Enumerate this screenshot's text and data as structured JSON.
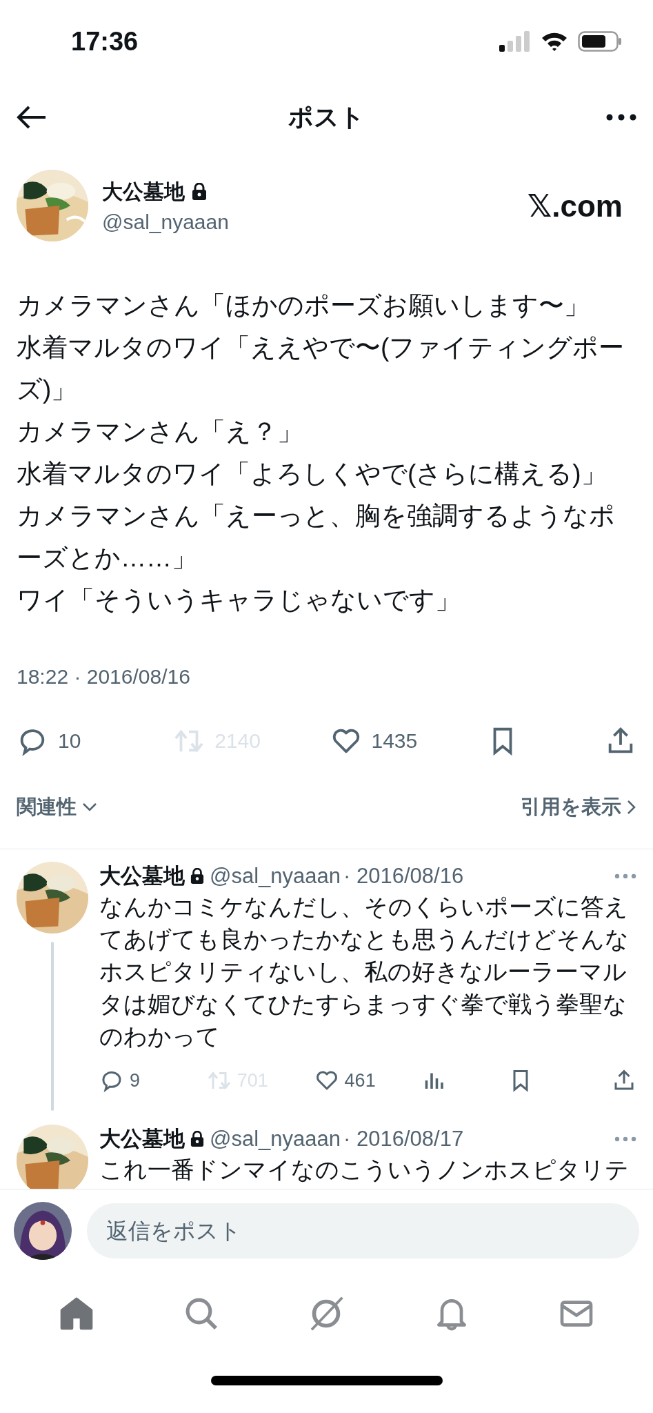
{
  "status_bar": {
    "time": "17:36"
  },
  "header": {
    "title": "ポスト"
  },
  "post": {
    "author": {
      "name": "大公墓地",
      "handle": "@sal_nyaaan",
      "locked": true
    },
    "source_label": "𝕏.com",
    "text_lines": [
      "カメラマンさん「ほかのポーズお願いします〜」",
      "水着マルタのワイ「ええやで〜(ファイティングポーズ)」",
      "カメラマンさん「え？」",
      "水着マルタのワイ「よろしくやで(さらに構える)」",
      "カメラマンさん「えーっと、胸を強調するようなポーズとか……」",
      "ワイ「そういうキャラじゃないです」"
    ],
    "timestamp": "18:22 · 2016/08/16",
    "actions": [
      {
        "kind": "reply",
        "count": "10",
        "disabled": false
      },
      {
        "kind": "repost",
        "count": "2140",
        "disabled": true
      },
      {
        "kind": "like",
        "count": "1435",
        "disabled": false
      },
      {
        "kind": "bookmark",
        "disabled": false
      },
      {
        "kind": "share",
        "disabled": false
      }
    ],
    "sort_label": "関連性",
    "quotes_link": "引用を表示"
  },
  "replies": [
    {
      "name": "大公墓地",
      "locked": true,
      "handle": "@sal_nyaaan",
      "date": "· 2016/08/16",
      "thread_line": true,
      "text": "なんかコミケなんだし、そのくらいポーズに答えてあげても良かったかなとも思うんだけどそんなホスピタリティないし、私の好きなルーラーマルタは媚びなくてひたすらまっすぐ拳で戦う拳聖なのわかって",
      "actions": [
        {
          "kind": "reply",
          "count": "9",
          "disabled": false
        },
        {
          "kind": "repost",
          "count": "701",
          "disabled": true
        },
        {
          "kind": "like",
          "count": "461",
          "disabled": false
        },
        {
          "kind": "views",
          "disabled": false
        },
        {
          "kind": "bookmark",
          "disabled": false
        },
        {
          "kind": "share",
          "disabled": false
        }
      ]
    },
    {
      "name": "大公墓地",
      "locked": true,
      "handle": "@sal_nyaaan",
      "date": "· 2016/08/17",
      "thread_line": false,
      "text": "これ一番ドンマイなのこういうノンホスピタリテ"
    }
  ],
  "composer": {
    "placeholder": "返信をポスト"
  },
  "tab_bar": [
    {
      "kind": "home",
      "selected": true
    },
    {
      "kind": "search",
      "selected": false
    },
    {
      "kind": "grok",
      "selected": false
    },
    {
      "kind": "notifications",
      "selected": false
    },
    {
      "kind": "messages",
      "selected": false
    }
  ]
}
